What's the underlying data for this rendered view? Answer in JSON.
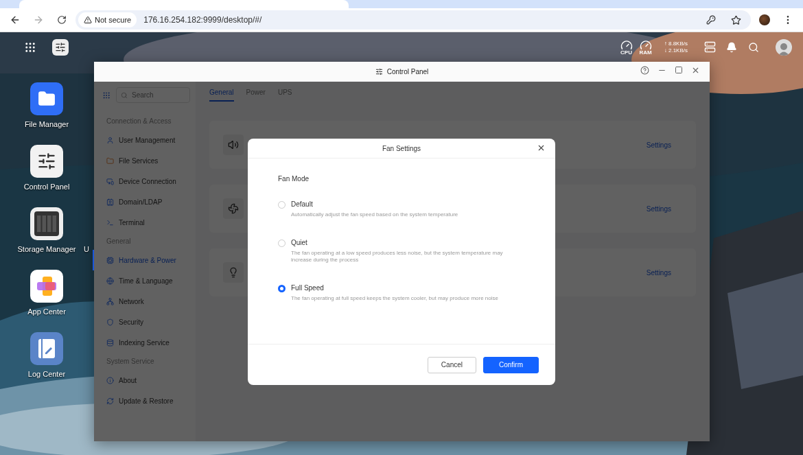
{
  "browser": {
    "security_label": "Not secure",
    "url": "176.16.254.182:9999/desktop/#/"
  },
  "top_bar": {
    "cpu_label": "CPU",
    "ram_label": "RAM",
    "upload": "↑ 8.8KB/s",
    "download": "↓ 2.1KB/s"
  },
  "desktop_icons": [
    {
      "label": "File Manager",
      "kind": "files"
    },
    {
      "label": "Control Panel",
      "kind": "control"
    },
    {
      "label": "Storage Manager",
      "kind": "storage"
    },
    {
      "label": "App Center",
      "kind": "apps"
    },
    {
      "label": "Log Center",
      "kind": "log"
    }
  ],
  "partial_label": "U",
  "window": {
    "title": "Control Panel",
    "search": {
      "placeholder": "Search"
    },
    "sidebar": [
      {
        "heading": "Connection & Access",
        "items": [
          {
            "label": "User Management",
            "selected": false
          },
          {
            "label": "File Services",
            "selected": false
          },
          {
            "label": "Device Connection",
            "selected": false
          },
          {
            "label": "Domain/LDAP",
            "selected": false
          },
          {
            "label": "Terminal",
            "selected": false
          }
        ]
      },
      {
        "heading": "General",
        "items": [
          {
            "label": "Hardware & Power",
            "selected": true
          },
          {
            "label": "Time & Language",
            "selected": false
          },
          {
            "label": "Network",
            "selected": false
          },
          {
            "label": "Security",
            "selected": false
          },
          {
            "label": "Indexing Service",
            "selected": false
          }
        ]
      },
      {
        "heading": "System Service",
        "items": [
          {
            "label": "About",
            "selected": false
          },
          {
            "label": "Update & Restore",
            "selected": false
          }
        ]
      }
    ],
    "tabs": [
      {
        "label": "General",
        "selected": true
      },
      {
        "label": "Power",
        "selected": false
      },
      {
        "label": "UPS",
        "selected": false
      }
    ],
    "cards": [
      {
        "kind": "sound",
        "action": "Settings"
      },
      {
        "kind": "fan",
        "action": "Settings"
      },
      {
        "kind": "light",
        "action": "Settings"
      }
    ]
  },
  "dialog": {
    "title": "Fan Settings",
    "section": "Fan Mode",
    "options": [
      {
        "label": "Default",
        "description": "Automatically adjust the fan speed based on the system temperature",
        "selected": false
      },
      {
        "label": "Quiet",
        "description": "The fan operating at a low speed produces less noise, but the system temperature may increase during the process",
        "selected": false
      },
      {
        "label": "Full Speed",
        "description": "The fan operating at full speed keeps the system cooler, but may produce more noise",
        "selected": true
      }
    ],
    "cancel": "Cancel",
    "confirm": "Confirm"
  }
}
